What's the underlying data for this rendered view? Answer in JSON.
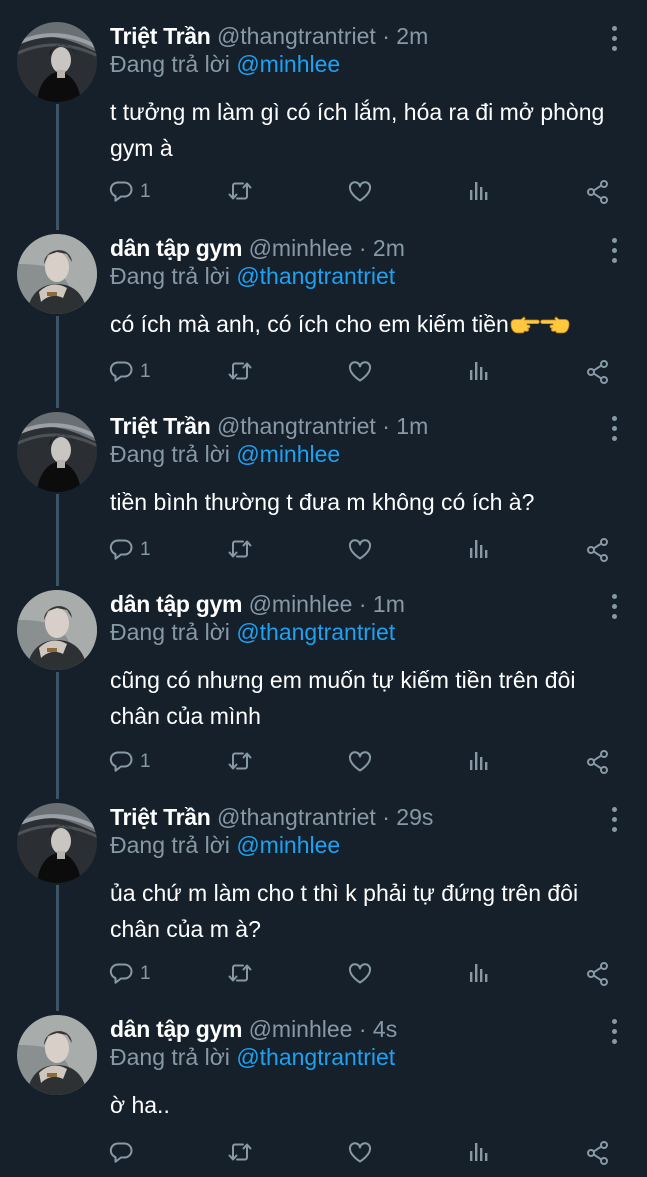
{
  "labels": {
    "replying_to": "Đang trả lời",
    "separator": "·"
  },
  "colors": {
    "background": "#15202b",
    "text": "#ffffff",
    "muted": "#8899a6",
    "link": "#1da1f2",
    "thread_line": "#3d5466"
  },
  "icons": [
    "more-vertical-icon",
    "reply-icon",
    "retweet-icon",
    "like-icon",
    "analytics-icon",
    "share-icon",
    "pointing-hand-emoji"
  ],
  "tweets": [
    {
      "author": "Triệt Trần",
      "handle": "@thangtrantriet",
      "time": "2m",
      "replying_to": "@minhlee",
      "text": "t tưởng m làm gì có ích lắm, hóa ra đi mở phòng gym à",
      "reply_count": "1"
    },
    {
      "author": "dân tập gym",
      "handle": "@minhlee",
      "time": "2m",
      "replying_to": "@thangtrantriet",
      "text": "có ích mà anh, có ích cho em kiếm tiền",
      "reply_count": "1"
    },
    {
      "author": "Triệt Trần",
      "handle": "@thangtrantriet",
      "time": "1m",
      "replying_to": "@minhlee",
      "text": "tiền bình thường t đưa m không có ích à?",
      "reply_count": "1"
    },
    {
      "author": "dân tập gym",
      "handle": "@minhlee",
      "time": "1m",
      "replying_to": "@thangtrantriet",
      "text": "cũng có nhưng em muốn tự kiếm tiền trên đôi chân của mình",
      "reply_count": "1"
    },
    {
      "author": "Triệt Trần",
      "handle": "@thangtrantriet",
      "time": "29s",
      "replying_to": "@minhlee",
      "text": "ủa chứ m làm cho t thì k phải tự đứng trên đôi chân của m à?",
      "reply_count": "1"
    },
    {
      "author": "dân tập gym",
      "handle": "@minhlee",
      "time": "4s",
      "replying_to": "@thangtrantriet",
      "text": "ờ ha..",
      "reply_count": ""
    }
  ]
}
